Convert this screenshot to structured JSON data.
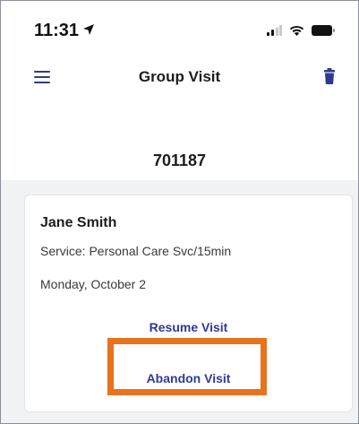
{
  "status_bar": {
    "time": "11:31",
    "icons": [
      "location-arrow-icon",
      "cellular-signal-icon",
      "wifi-icon",
      "battery-icon"
    ]
  },
  "header": {
    "title": "Group Visit",
    "menu_icon": "hamburger-menu-icon",
    "delete_icon": "trash-icon"
  },
  "visit": {
    "id": "701187"
  },
  "card": {
    "client_name": "Jane Smith",
    "service": "Service: Personal Care Svc/15min",
    "date": "Monday, October 2",
    "resume_label": "Resume Visit",
    "abandon_label": "Abandon Visit"
  },
  "colors": {
    "accent": "#2e3a9a",
    "highlight": "#e8731c",
    "background_gray": "#f1f2f4"
  }
}
